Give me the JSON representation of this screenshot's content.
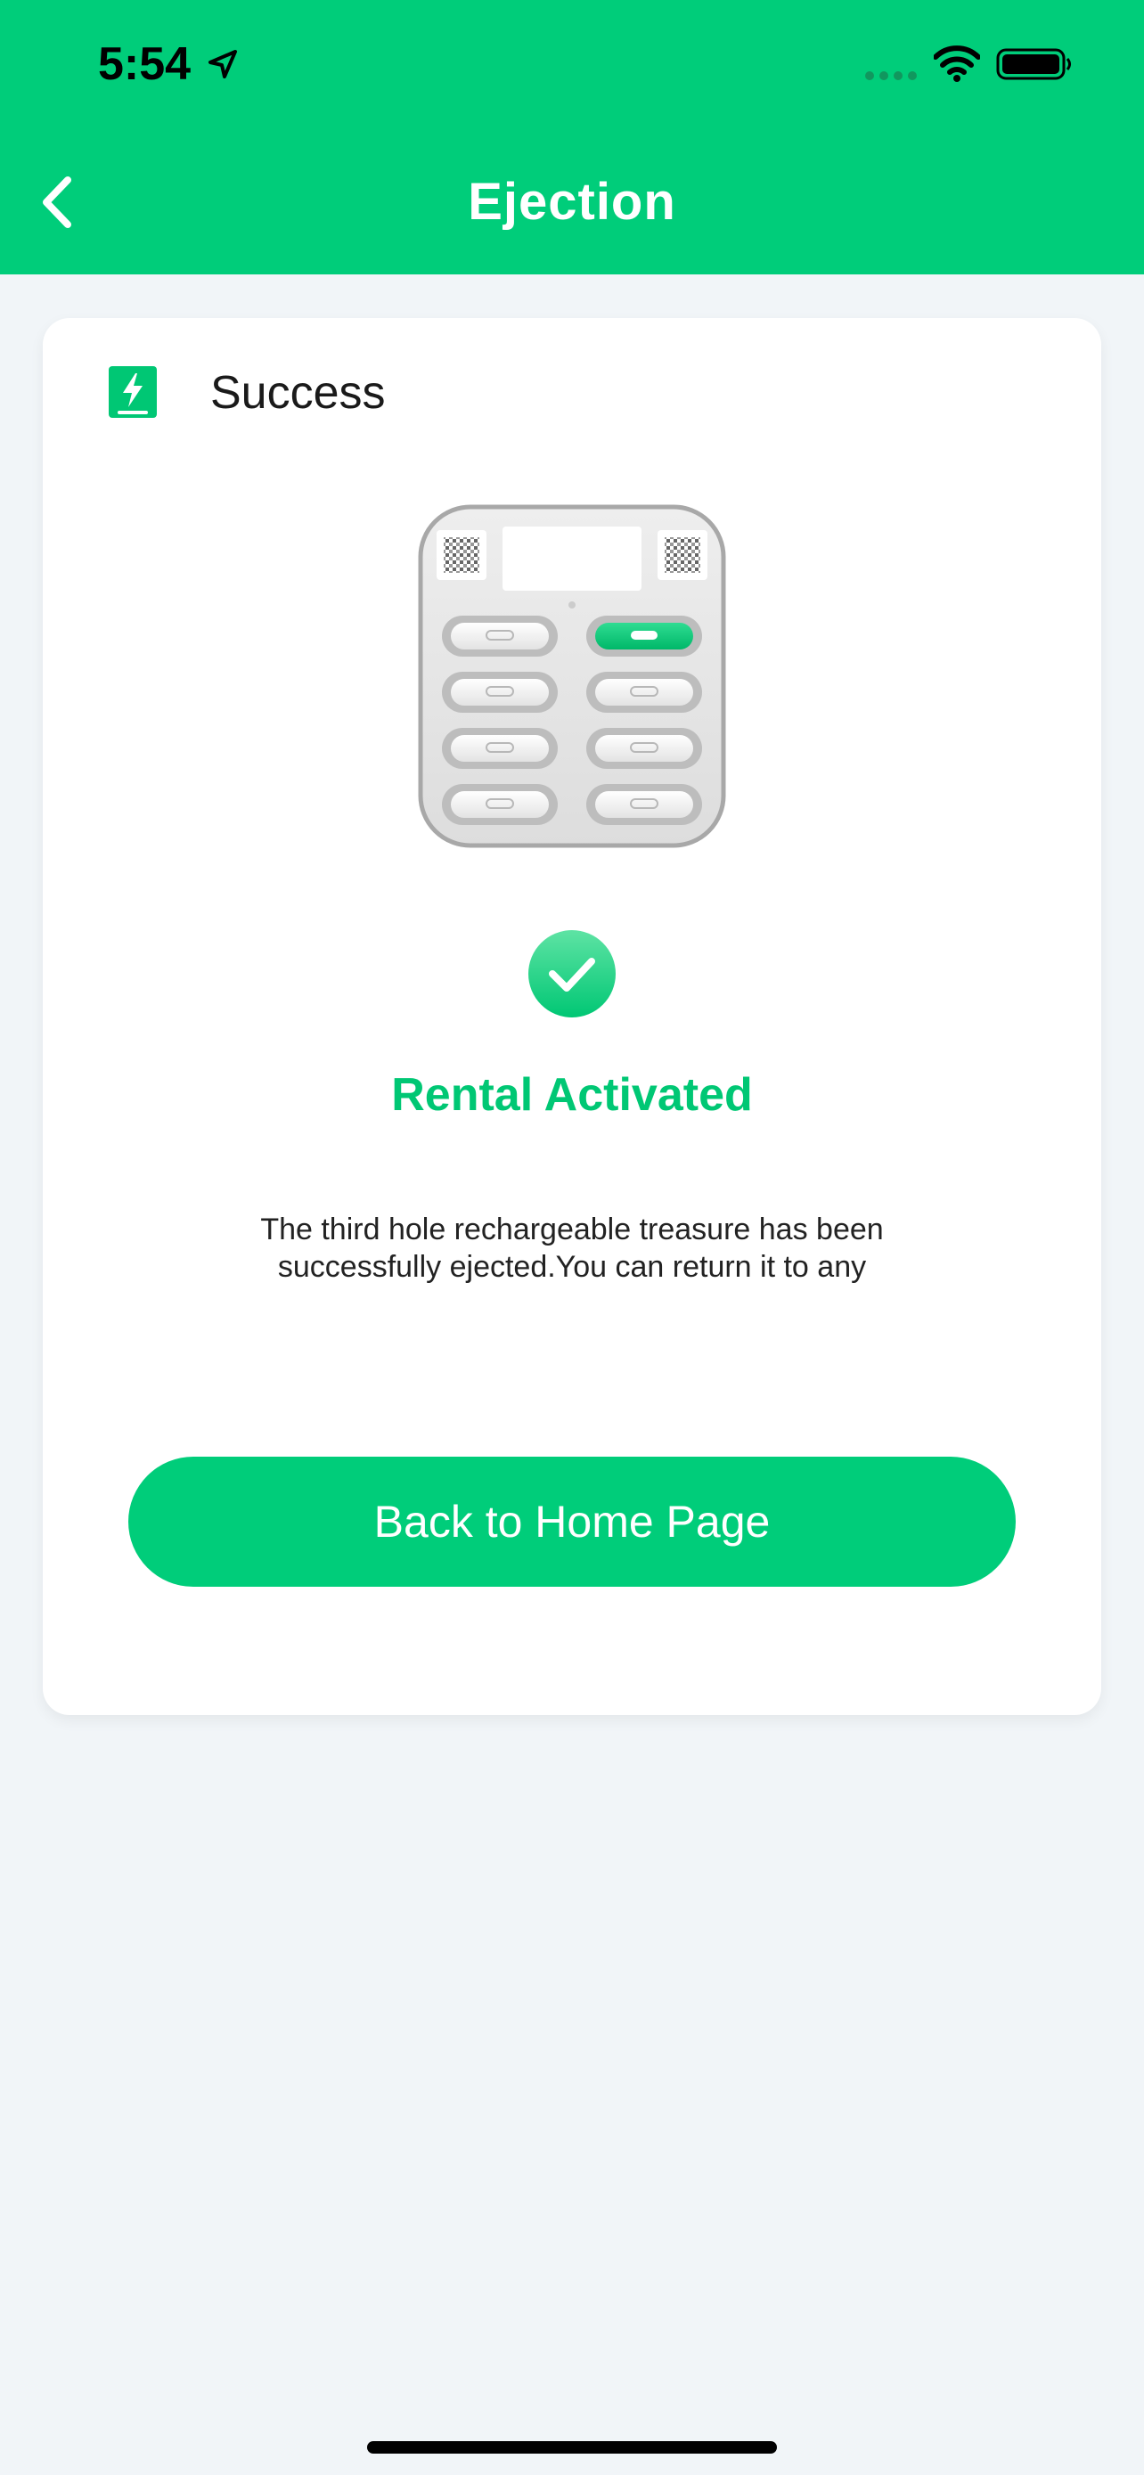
{
  "status_bar": {
    "time": "5:54"
  },
  "nav": {
    "title": "Ejection"
  },
  "card": {
    "header_label": "Success",
    "status_title": "Rental Activated",
    "message": "The third hole rechargeable treasure has been successfully ejected.You can return it to any",
    "button_label": "Back to Home Page"
  },
  "colors": {
    "brand": "#00cd7a",
    "status_text": "#00c774",
    "background": "#f1f5f8"
  },
  "icons": {
    "back": "chevron-left-icon",
    "header": "powerbank-card-icon",
    "success": "check-circle-icon"
  }
}
